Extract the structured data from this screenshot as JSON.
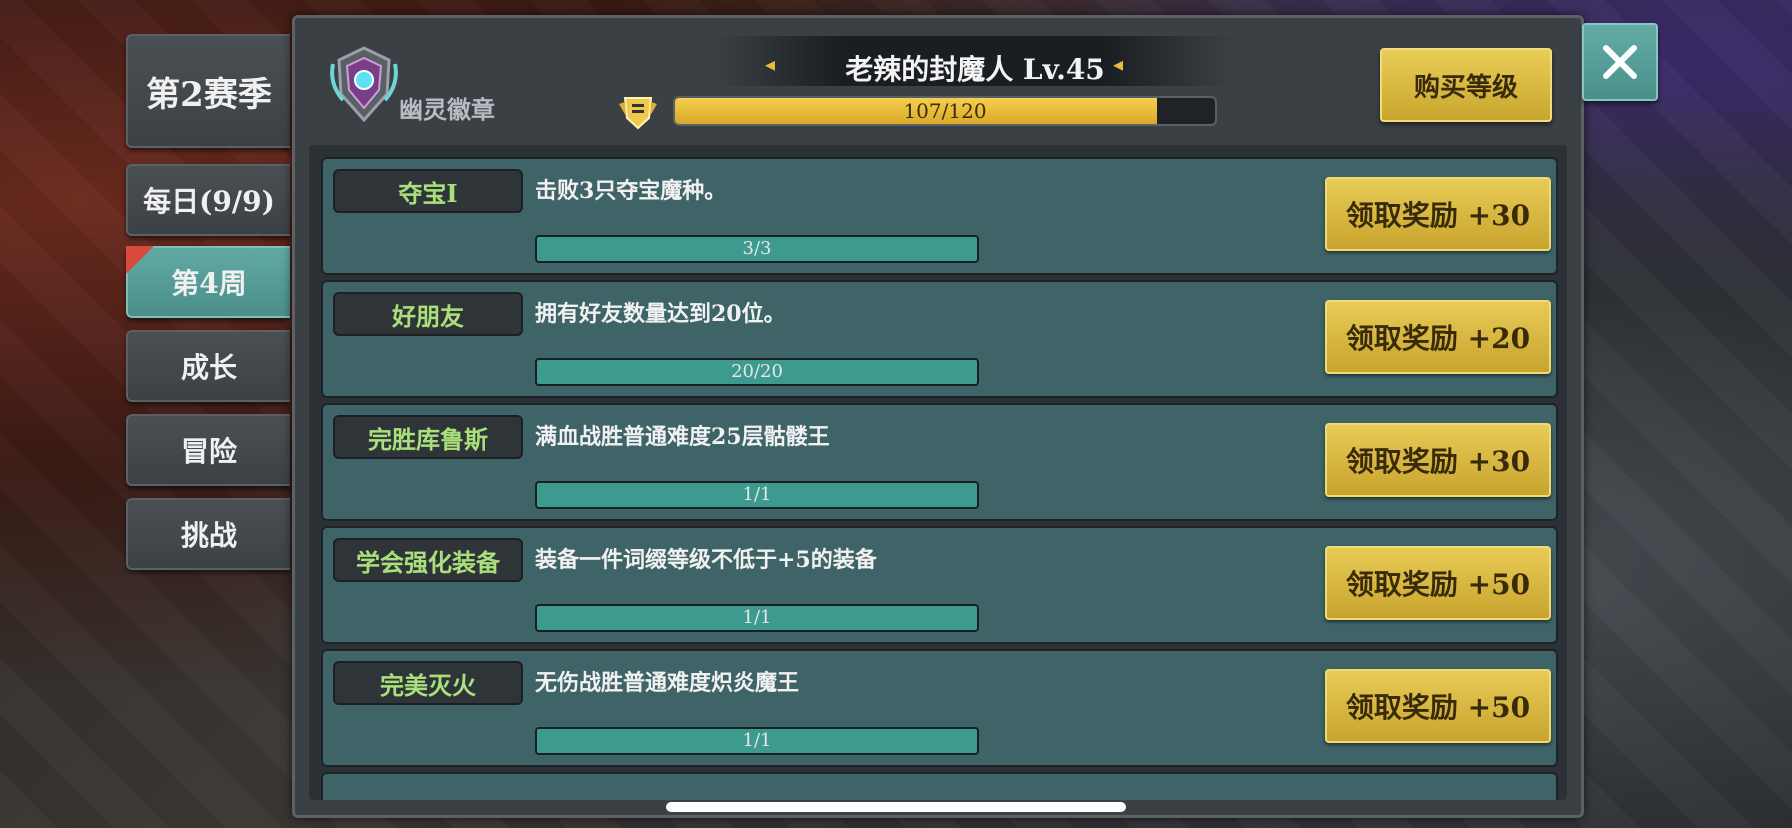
{
  "tabs": {
    "season": "第2赛季",
    "daily": "每日(9/9)",
    "week": "第4周",
    "growth": "成长",
    "adventure": "冒险",
    "challenge": "挑战"
  },
  "header": {
    "badge_name": "幽灵徽章",
    "title": "老辣的封魔人  Lv.45",
    "xp_text": "107/120",
    "xp_fraction": 0.8917,
    "buy_label": "购买等级"
  },
  "tasks": [
    {
      "name": "夺宝I",
      "desc": "击败3只夺宝魔种。",
      "progress": "3/3",
      "reward": "领取奖励 +30"
    },
    {
      "name": "好朋友",
      "desc": "拥有好友数量达到20位。",
      "progress": "20/20",
      "reward": "领取奖励 +20"
    },
    {
      "name": "完胜库鲁斯",
      "desc": "满血战胜普通难度25层骷髅王",
      "progress": "1/1",
      "reward": "领取奖励 +30"
    },
    {
      "name": "学会强化装备",
      "desc": "装备一件词缀等级不低于+5的装备",
      "progress": "1/1",
      "reward": "领取奖励 +50"
    },
    {
      "name": "完美灭火",
      "desc": "无伤战胜普通难度炽炎魔王",
      "progress": "1/1",
      "reward": "领取奖励 +50"
    }
  ],
  "colors": {
    "accent_gold": "#e8cb56",
    "teal": "#4b8e89",
    "name_green": "#a9e07c"
  }
}
